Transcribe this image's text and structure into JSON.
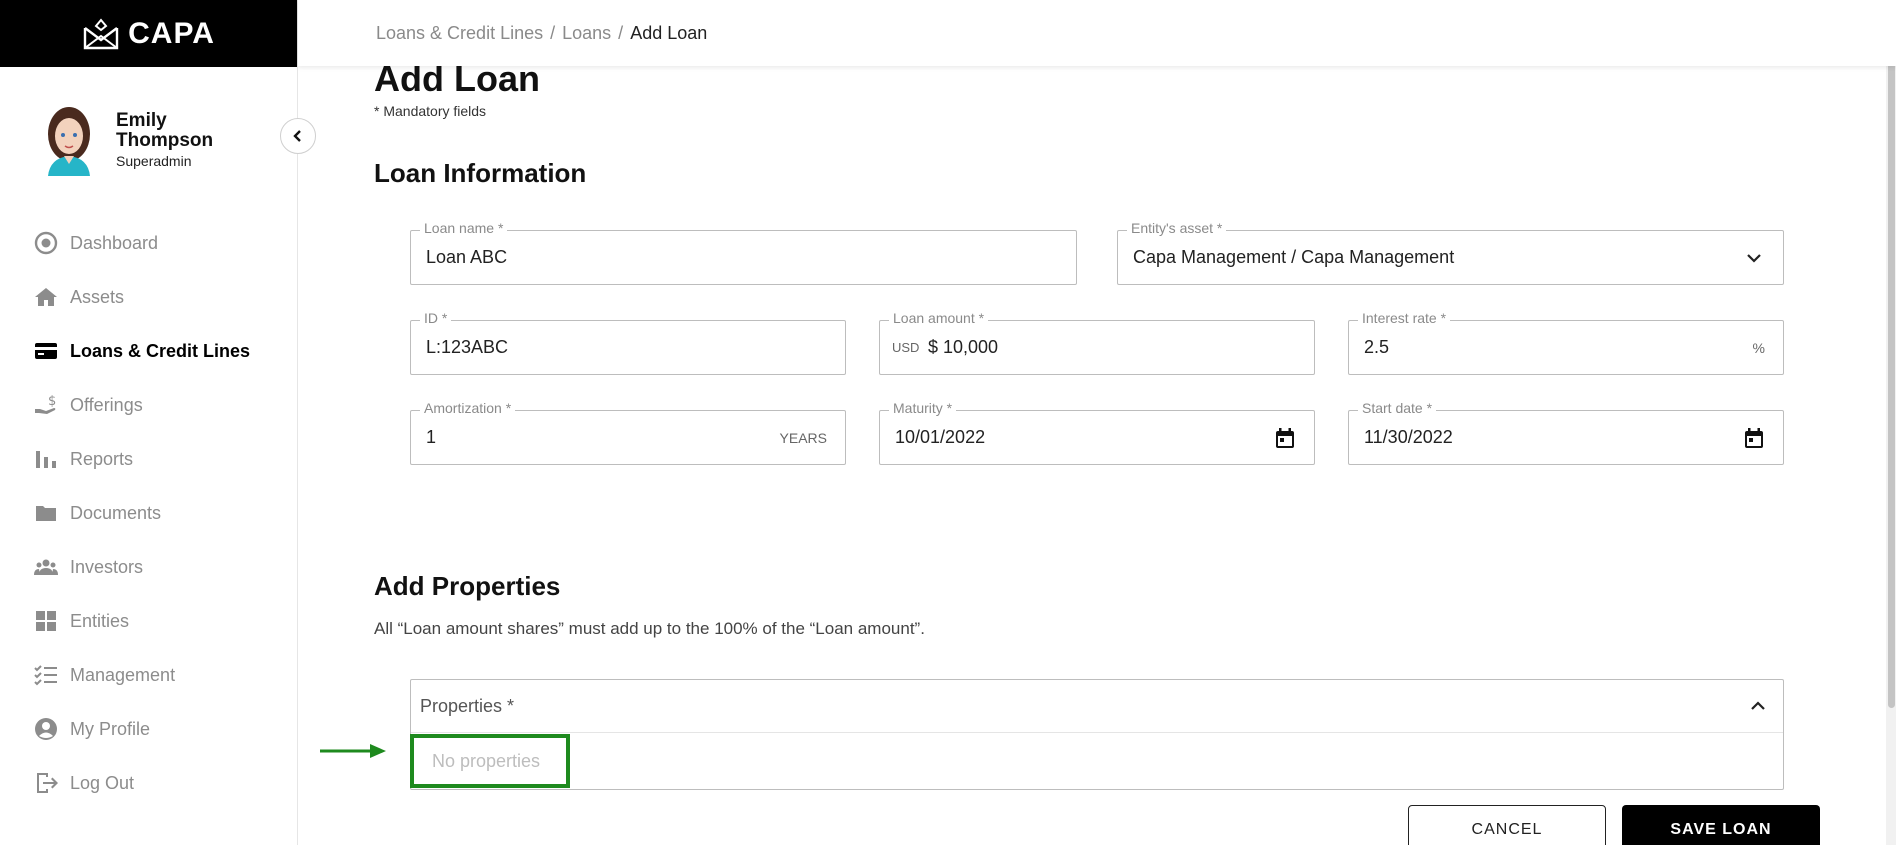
{
  "brand": {
    "name": "CAPA"
  },
  "user": {
    "name": "Emily Thompson",
    "role": "Superadmin"
  },
  "nav": {
    "items": [
      {
        "label": "Dashboard",
        "icon": "dashboard-icon"
      },
      {
        "label": "Assets",
        "icon": "home-icon"
      },
      {
        "label": "Loans & Credit Lines",
        "icon": "credit-card-icon",
        "active": true
      },
      {
        "label": "Offerings",
        "icon": "offering-hand-icon"
      },
      {
        "label": "Reports",
        "icon": "bar-chart-icon"
      },
      {
        "label": "Documents",
        "icon": "folder-icon"
      },
      {
        "label": "Investors",
        "icon": "people-icon"
      },
      {
        "label": "Entities",
        "icon": "grid-icon"
      },
      {
        "label": "Management",
        "icon": "checklist-icon"
      },
      {
        "label": "My Profile",
        "icon": "user-circle-icon"
      },
      {
        "label": "Log Out",
        "icon": "logout-icon"
      }
    ]
  },
  "breadcrumb": {
    "level1": "Loans & Credit Lines",
    "sep": "/",
    "level2": "Loans",
    "current": "Add Loan"
  },
  "page": {
    "title": "Add Loan",
    "mandatory_note": "* Mandatory fields"
  },
  "loan_info": {
    "section_title": "Loan Information",
    "loan_name": {
      "label": "Loan name *",
      "value": "Loan ABC"
    },
    "entity_asset": {
      "label": "Entity's asset *",
      "value": "Capa Management / Capa Management"
    },
    "id": {
      "label": "ID *",
      "value": "L:123ABC"
    },
    "loan_amount": {
      "label": "Loan amount *",
      "currency": "USD",
      "value": "$ 10,000"
    },
    "interest_rate": {
      "label": "Interest rate *",
      "value": "2.5",
      "unit": "%"
    },
    "amortization": {
      "label": "Amortization *",
      "value": "1",
      "unit": "YEARS"
    },
    "maturity": {
      "label": "Maturity *",
      "value": "10/01/2022"
    },
    "start_date": {
      "label": "Start date *",
      "value": "11/30/2022"
    }
  },
  "properties": {
    "section_title": "Add Properties",
    "description": "All “Loan amount shares” must add up to the 100% of the “Loan amount”.",
    "dropdown_label": "Properties *",
    "empty_text": "No properties"
  },
  "actions": {
    "cancel": "CANCEL",
    "save": "SAVE LOAN"
  },
  "colors": {
    "highlight": "#1e8a1e",
    "sidebar_header": "#000000",
    "muted_text": "#8c8c8c"
  }
}
